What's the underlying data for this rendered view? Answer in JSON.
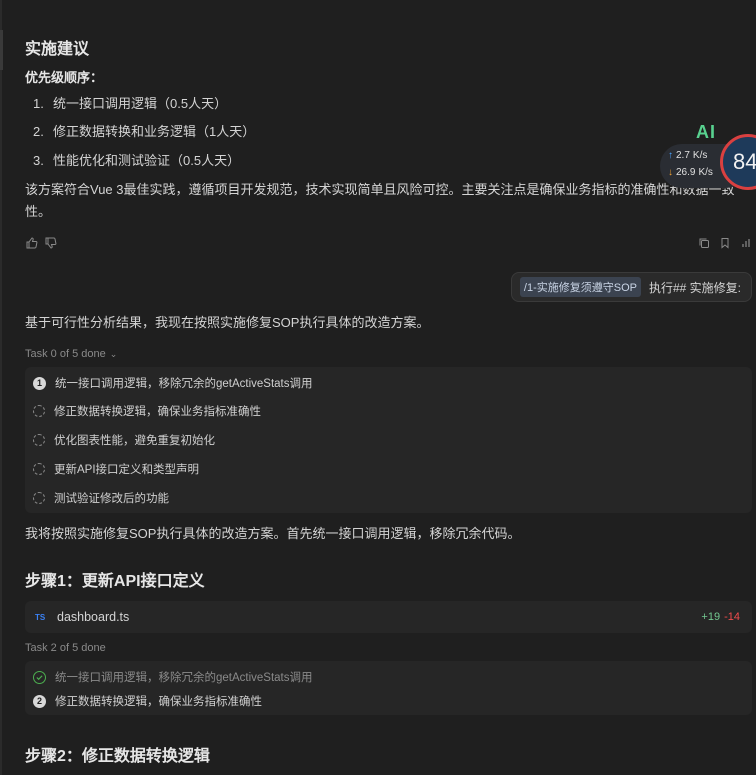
{
  "section": {
    "title": "实施建议",
    "priority_heading": "优先级顺序：",
    "items": [
      {
        "num": "1.",
        "text": "统一接口调用逻辑（0.5人天）"
      },
      {
        "num": "2.",
        "text": "修正数据转换和业务逻辑（1人天）"
      },
      {
        "num": "3.",
        "text": "性能优化和测试验证（0.5人天）"
      }
    ],
    "summary": "该方案符合Vue 3最佳实践，遵循项目开发规范，技术实现简单且风险可控。主要关注点是确保业务指标的准确性和数据一致性。"
  },
  "message_icons": {
    "feedback": [
      "thumbs-up-icon",
      "thumbs-down-icon"
    ],
    "actions": [
      "copy-icon",
      "bookmark-icon",
      "stats-icon"
    ]
  },
  "user_message": {
    "chip": "/1-实施修复须遵守SOP",
    "text": "执行## 实施修复:"
  },
  "assistant": {
    "intro": "基于可行性分析结果，我现在按照实施修复SOP执行具体的改造方案。",
    "task_list_1": {
      "header": "Task 0 of 5 done",
      "tasks": [
        {
          "badge": "1",
          "text": "统一接口调用逻辑，移除冗余的getActiveStats调用"
        },
        {
          "text": "修正数据转换逻辑，确保业务指标准确性"
        },
        {
          "text": "优化图表性能，避免重复初始化"
        },
        {
          "text": "更新API接口定义和类型声明"
        },
        {
          "text": "测试验证修改后的功能"
        }
      ]
    },
    "plan": "我将按照实施修复SOP执行具体的改造方案。首先统一接口调用逻辑，移除冗余代码。",
    "step1": "步骤1：更新API接口定义",
    "file": {
      "badge": "TS",
      "name": "dashboard.ts",
      "added": "+19",
      "removed": "-14"
    },
    "task_list_2": {
      "header": "Task 2 of 5 done",
      "tasks": [
        {
          "text": "统一接口调用逻辑，移除冗余的getActiveStats调用"
        },
        {
          "badge": "2",
          "text": "修正数据转换逻辑，确保业务指标准确性"
        }
      ]
    },
    "step2": "步骤2：修正数据转换逻辑"
  },
  "overlay": {
    "ai_label": "AI",
    "upload": "2.7",
    "download": "26.9",
    "unit": "K/s",
    "gauge": "84"
  },
  "colors": {
    "accent_green": "#73c991",
    "accent_red": "#f14c4c",
    "ts_blue": "#3b82f6"
  }
}
